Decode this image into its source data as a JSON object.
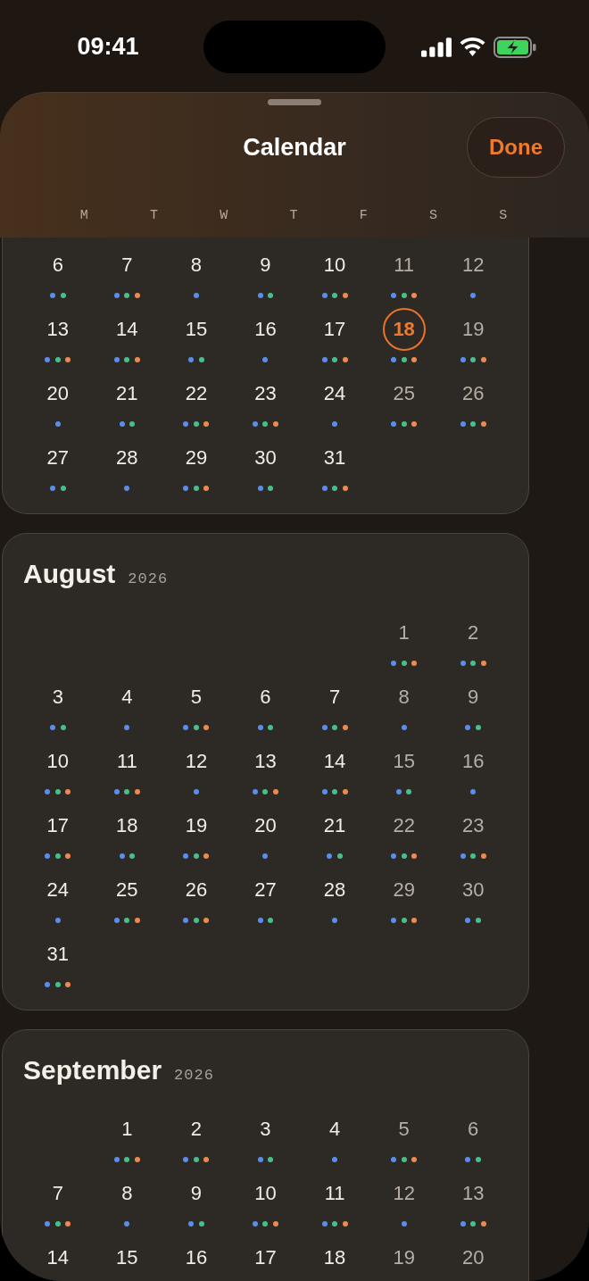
{
  "status_bar": {
    "time": "09:41"
  },
  "sheet": {
    "title": "Calendar",
    "done_button": "Done",
    "weekdays": [
      "M",
      "T",
      "W",
      "T",
      "F",
      "S",
      "S"
    ]
  },
  "months": [
    {
      "weeks": [
        [
          {
            "kind": "day",
            "label": "6",
            "weekend": false,
            "selected": false,
            "dots": [
              {
                "color": "#5b8cef"
              },
              {
                "color": "#45c08b"
              }
            ]
          },
          {
            "kind": "day",
            "label": "7",
            "weekend": false,
            "selected": false,
            "dots": [
              {
                "color": "#5b8cef"
              },
              {
                "color": "#45c08b"
              },
              {
                "color": "#ec8a50"
              }
            ]
          },
          {
            "kind": "day",
            "label": "8",
            "weekend": false,
            "selected": false,
            "dots": [
              {
                "color": "#5b8cef"
              }
            ]
          },
          {
            "kind": "day",
            "label": "9",
            "weekend": false,
            "selected": false,
            "dots": [
              {
                "color": "#5b8cef"
              },
              {
                "color": "#45c08b"
              }
            ]
          },
          {
            "kind": "day",
            "label": "10",
            "weekend": false,
            "selected": false,
            "dots": [
              {
                "color": "#5b8cef"
              },
              {
                "color": "#45c08b"
              },
              {
                "color": "#ec8a50"
              }
            ]
          },
          {
            "kind": "day",
            "label": "11",
            "weekend": true,
            "selected": false,
            "dots": [
              {
                "color": "#5b8cef"
              },
              {
                "color": "#45c08b"
              },
              {
                "color": "#ec8a50"
              }
            ]
          },
          {
            "kind": "day",
            "label": "12",
            "weekend": true,
            "selected": false,
            "dots": [
              {
                "color": "#5b8cef"
              }
            ]
          }
        ],
        [
          {
            "kind": "day",
            "label": "13",
            "weekend": false,
            "selected": false,
            "dots": [
              {
                "color": "#5b8cef"
              },
              {
                "color": "#45c08b"
              },
              {
                "color": "#ec8a50"
              }
            ]
          },
          {
            "kind": "day",
            "label": "14",
            "weekend": false,
            "selected": false,
            "dots": [
              {
                "color": "#5b8cef"
              },
              {
                "color": "#45c08b"
              },
              {
                "color": "#ec8a50"
              }
            ]
          },
          {
            "kind": "day",
            "label": "15",
            "weekend": false,
            "selected": false,
            "dots": [
              {
                "color": "#5b8cef"
              },
              {
                "color": "#45c08b"
              }
            ]
          },
          {
            "kind": "day",
            "label": "16",
            "weekend": false,
            "selected": false,
            "dots": [
              {
                "color": "#5b8cef"
              }
            ]
          },
          {
            "kind": "day",
            "label": "17",
            "weekend": false,
            "selected": false,
            "dots": [
              {
                "color": "#5b8cef"
              },
              {
                "color": "#45c08b"
              },
              {
                "color": "#ec8a50"
              }
            ]
          },
          {
            "kind": "day",
            "label": "18",
            "selected": true,
            "dots": [
              {
                "color": "#5b8cef"
              },
              {
                "color": "#45c08b"
              },
              {
                "color": "#ec8a50"
              }
            ]
          },
          {
            "kind": "day",
            "label": "19",
            "weekend": true,
            "selected": false,
            "dots": [
              {
                "color": "#5b8cef"
              },
              {
                "color": "#45c08b"
              },
              {
                "color": "#ec8a50"
              }
            ]
          }
        ],
        [
          {
            "kind": "day",
            "label": "20",
            "weekend": false,
            "selected": false,
            "dots": [
              {
                "color": "#5b8cef"
              }
            ]
          },
          {
            "kind": "day",
            "label": "21",
            "weekend": false,
            "selected": false,
            "dots": [
              {
                "color": "#5b8cef"
              },
              {
                "color": "#45c08b"
              }
            ]
          },
          {
            "kind": "day",
            "label": "22",
            "weekend": false,
            "selected": false,
            "dots": [
              {
                "color": "#5b8cef"
              },
              {
                "color": "#45c08b"
              },
              {
                "color": "#ec8a50"
              }
            ]
          },
          {
            "kind": "day",
            "label": "23",
            "weekend": false,
            "selected": false,
            "dots": [
              {
                "color": "#5b8cef"
              },
              {
                "color": "#45c08b"
              },
              {
                "color": "#ec8a50"
              }
            ]
          },
          {
            "kind": "day",
            "label": "24",
            "weekend": false,
            "selected": false,
            "dots": [
              {
                "color": "#5b8cef"
              }
            ]
          },
          {
            "kind": "day",
            "label": "25",
            "weekend": true,
            "selected": false,
            "dots": [
              {
                "color": "#5b8cef"
              },
              {
                "color": "#45c08b"
              },
              {
                "color": "#ec8a50"
              }
            ]
          },
          {
            "kind": "day",
            "label": "26",
            "weekend": true,
            "selected": false,
            "dots": [
              {
                "color": "#5b8cef"
              },
              {
                "color": "#45c08b"
              },
              {
                "color": "#ec8a50"
              }
            ]
          }
        ],
        [
          {
            "kind": "day",
            "label": "27",
            "weekend": false,
            "selected": false,
            "dots": [
              {
                "color": "#5b8cef"
              },
              {
                "color": "#45c08b"
              }
            ]
          },
          {
            "kind": "day",
            "label": "28",
            "weekend": false,
            "selected": false,
            "dots": [
              {
                "color": "#5b8cef"
              }
            ]
          },
          {
            "kind": "day",
            "label": "29",
            "weekend": false,
            "selected": false,
            "dots": [
              {
                "color": "#5b8cef"
              },
              {
                "color": "#45c08b"
              },
              {
                "color": "#ec8a50"
              }
            ]
          },
          {
            "kind": "day",
            "label": "30",
            "weekend": false,
            "selected": false,
            "dots": [
              {
                "color": "#5b8cef"
              },
              {
                "color": "#45c08b"
              }
            ]
          },
          {
            "kind": "day",
            "label": "31",
            "weekend": false,
            "selected": false,
            "dots": [
              {
                "color": "#5b8cef"
              },
              {
                "color": "#45c08b"
              },
              {
                "color": "#ec8a50"
              }
            ]
          }
        ]
      ]
    },
    {
      "name": "August",
      "year": "2026",
      "weeks": [
        [
          {
            "kind": "empty"
          },
          {
            "kind": "empty"
          },
          {
            "kind": "empty"
          },
          {
            "kind": "empty"
          },
          {
            "kind": "empty"
          },
          {
            "kind": "day",
            "label": "1",
            "weekend": true,
            "selected": false,
            "dots": [
              {
                "color": "#5b8cef"
              },
              {
                "color": "#45c08b"
              },
              {
                "color": "#ec8a50"
              }
            ]
          },
          {
            "kind": "day",
            "label": "2",
            "weekend": true,
            "selected": false,
            "dots": [
              {
                "color": "#5b8cef"
              },
              {
                "color": "#45c08b"
              },
              {
                "color": "#ec8a50"
              }
            ]
          }
        ],
        [
          {
            "kind": "day",
            "label": "3",
            "weekend": false,
            "selected": false,
            "dots": [
              {
                "color": "#5b8cef"
              },
              {
                "color": "#45c08b"
              }
            ]
          },
          {
            "kind": "day",
            "label": "4",
            "weekend": false,
            "selected": false,
            "dots": [
              {
                "color": "#5b8cef"
              }
            ]
          },
          {
            "kind": "day",
            "label": "5",
            "weekend": false,
            "selected": false,
            "dots": [
              {
                "color": "#5b8cef"
              },
              {
                "color": "#45c08b"
              },
              {
                "color": "#ec8a50"
              }
            ]
          },
          {
            "kind": "day",
            "label": "6",
            "weekend": false,
            "selected": false,
            "dots": [
              {
                "color": "#5b8cef"
              },
              {
                "color": "#45c08b"
              }
            ]
          },
          {
            "kind": "day",
            "label": "7",
            "weekend": false,
            "selected": false,
            "dots": [
              {
                "color": "#5b8cef"
              },
              {
                "color": "#45c08b"
              },
              {
                "color": "#ec8a50"
              }
            ]
          },
          {
            "kind": "day",
            "label": "8",
            "weekend": true,
            "selected": false,
            "dots": [
              {
                "color": "#5b8cef"
              }
            ]
          },
          {
            "kind": "day",
            "label": "9",
            "weekend": true,
            "selected": false,
            "dots": [
              {
                "color": "#5b8cef"
              },
              {
                "color": "#45c08b"
              }
            ]
          }
        ],
        [
          {
            "kind": "day",
            "label": "10",
            "weekend": false,
            "selected": false,
            "dots": [
              {
                "color": "#5b8cef"
              },
              {
                "color": "#45c08b"
              },
              {
                "color": "#ec8a50"
              }
            ]
          },
          {
            "kind": "day",
            "label": "11",
            "weekend": false,
            "selected": false,
            "dots": [
              {
                "color": "#5b8cef"
              },
              {
                "color": "#45c08b"
              },
              {
                "color": "#ec8a50"
              }
            ]
          },
          {
            "kind": "day",
            "label": "12",
            "weekend": false,
            "selected": false,
            "dots": [
              {
                "color": "#5b8cef"
              }
            ]
          },
          {
            "kind": "day",
            "label": "13",
            "weekend": false,
            "selected": false,
            "dots": [
              {
                "color": "#5b8cef"
              },
              {
                "color": "#45c08b"
              },
              {
                "color": "#ec8a50"
              }
            ]
          },
          {
            "kind": "day",
            "label": "14",
            "weekend": false,
            "selected": false,
            "dots": [
              {
                "color": "#5b8cef"
              },
              {
                "color": "#45c08b"
              },
              {
                "color": "#ec8a50"
              }
            ]
          },
          {
            "kind": "day",
            "label": "15",
            "weekend": true,
            "selected": false,
            "dots": [
              {
                "color": "#5b8cef"
              },
              {
                "color": "#45c08b"
              }
            ]
          },
          {
            "kind": "day",
            "label": "16",
            "weekend": true,
            "selected": false,
            "dots": [
              {
                "color": "#5b8cef"
              }
            ]
          }
        ],
        [
          {
            "kind": "day",
            "label": "17",
            "weekend": false,
            "selected": false,
            "dots": [
              {
                "color": "#5b8cef"
              },
              {
                "color": "#45c08b"
              },
              {
                "color": "#ec8a50"
              }
            ]
          },
          {
            "kind": "day",
            "label": "18",
            "weekend": false,
            "selected": false,
            "dots": [
              {
                "color": "#5b8cef"
              },
              {
                "color": "#45c08b"
              }
            ]
          },
          {
            "kind": "day",
            "label": "19",
            "weekend": false,
            "selected": false,
            "dots": [
              {
                "color": "#5b8cef"
              },
              {
                "color": "#45c08b"
              },
              {
                "color": "#ec8a50"
              }
            ]
          },
          {
            "kind": "day",
            "label": "20",
            "weekend": false,
            "selected": false,
            "dots": [
              {
                "color": "#5b8cef"
              }
            ]
          },
          {
            "kind": "day",
            "label": "21",
            "weekend": false,
            "selected": false,
            "dots": [
              {
                "color": "#5b8cef"
              },
              {
                "color": "#45c08b"
              }
            ]
          },
          {
            "kind": "day",
            "label": "22",
            "weekend": true,
            "selected": false,
            "dots": [
              {
                "color": "#5b8cef"
              },
              {
                "color": "#45c08b"
              },
              {
                "color": "#ec8a50"
              }
            ]
          },
          {
            "kind": "day",
            "label": "23",
            "weekend": true,
            "selected": false,
            "dots": [
              {
                "color": "#5b8cef"
              },
              {
                "color": "#45c08b"
              },
              {
                "color": "#ec8a50"
              }
            ]
          }
        ],
        [
          {
            "kind": "day",
            "label": "24",
            "weekend": false,
            "selected": false,
            "dots": [
              {
                "color": "#5b8cef"
              }
            ]
          },
          {
            "kind": "day",
            "label": "25",
            "weekend": false,
            "selected": false,
            "dots": [
              {
                "color": "#5b8cef"
              },
              {
                "color": "#45c08b"
              },
              {
                "color": "#ec8a50"
              }
            ]
          },
          {
            "kind": "day",
            "label": "26",
            "weekend": false,
            "selected": false,
            "dots": [
              {
                "color": "#5b8cef"
              },
              {
                "color": "#45c08b"
              },
              {
                "color": "#ec8a50"
              }
            ]
          },
          {
            "kind": "day",
            "label": "27",
            "weekend": false,
            "selected": false,
            "dots": [
              {
                "color": "#5b8cef"
              },
              {
                "color": "#45c08b"
              }
            ]
          },
          {
            "kind": "day",
            "label": "28",
            "weekend": false,
            "selected": false,
            "dots": [
              {
                "color": "#5b8cef"
              }
            ]
          },
          {
            "kind": "day",
            "label": "29",
            "weekend": true,
            "selected": false,
            "dots": [
              {
                "color": "#5b8cef"
              },
              {
                "color": "#45c08b"
              },
              {
                "color": "#ec8a50"
              }
            ]
          },
          {
            "kind": "day",
            "label": "30",
            "weekend": true,
            "selected": false,
            "dots": [
              {
                "color": "#5b8cef"
              },
              {
                "color": "#45c08b"
              }
            ]
          }
        ],
        [
          {
            "kind": "day",
            "label": "31",
            "weekend": false,
            "selected": false,
            "dots": [
              {
                "color": "#5b8cef"
              },
              {
                "color": "#45c08b"
              },
              {
                "color": "#ec8a50"
              }
            ]
          }
        ]
      ]
    },
    {
      "name": "September",
      "year": "2026",
      "weeks": [
        [
          {
            "kind": "empty"
          },
          {
            "kind": "day",
            "label": "1",
            "weekend": false,
            "selected": false,
            "dots": [
              {
                "color": "#5b8cef"
              },
              {
                "color": "#45c08b"
              },
              {
                "color": "#ec8a50"
              }
            ]
          },
          {
            "kind": "day",
            "label": "2",
            "weekend": false,
            "selected": false,
            "dots": [
              {
                "color": "#5b8cef"
              },
              {
                "color": "#45c08b"
              },
              {
                "color": "#ec8a50"
              }
            ]
          },
          {
            "kind": "day",
            "label": "3",
            "weekend": false,
            "selected": false,
            "dots": [
              {
                "color": "#5b8cef"
              },
              {
                "color": "#45c08b"
              }
            ]
          },
          {
            "kind": "day",
            "label": "4",
            "weekend": false,
            "selected": false,
            "dots": [
              {
                "color": "#5b8cef"
              }
            ]
          },
          {
            "kind": "day",
            "label": "5",
            "weekend": true,
            "selected": false,
            "dots": [
              {
                "color": "#5b8cef"
              },
              {
                "color": "#45c08b"
              },
              {
                "color": "#ec8a50"
              }
            ]
          },
          {
            "kind": "day",
            "label": "6",
            "weekend": true,
            "selected": false,
            "dots": [
              {
                "color": "#5b8cef"
              },
              {
                "color": "#45c08b"
              }
            ]
          }
        ],
        [
          {
            "kind": "day",
            "label": "7",
            "weekend": false,
            "selected": false,
            "dots": [
              {
                "color": "#5b8cef"
              },
              {
                "color": "#45c08b"
              },
              {
                "color": "#ec8a50"
              }
            ]
          },
          {
            "kind": "day",
            "label": "8",
            "weekend": false,
            "selected": false,
            "dots": [
              {
                "color": "#5b8cef"
              }
            ]
          },
          {
            "kind": "day",
            "label": "9",
            "weekend": false,
            "selected": false,
            "dots": [
              {
                "color": "#5b8cef"
              },
              {
                "color": "#45c08b"
              }
            ]
          },
          {
            "kind": "day",
            "label": "10",
            "weekend": false,
            "selected": false,
            "dots": [
              {
                "color": "#5b8cef"
              },
              {
                "color": "#45c08b"
              },
              {
                "color": "#ec8a50"
              }
            ]
          },
          {
            "kind": "day",
            "label": "11",
            "weekend": false,
            "selected": false,
            "dots": [
              {
                "color": "#5b8cef"
              },
              {
                "color": "#45c08b"
              },
              {
                "color": "#ec8a50"
              }
            ]
          },
          {
            "kind": "day",
            "label": "12",
            "weekend": true,
            "selected": false,
            "dots": [
              {
                "color": "#5b8cef"
              }
            ]
          },
          {
            "kind": "day",
            "label": "13",
            "weekend": true,
            "selected": false,
            "dots": [
              {
                "color": "#5b8cef"
              },
              {
                "color": "#45c08b"
              },
              {
                "color": "#ec8a50"
              }
            ]
          }
        ],
        [
          {
            "kind": "day",
            "label": "14",
            "weekend": false,
            "selected": false
          },
          {
            "kind": "day",
            "label": "15",
            "weekend": false,
            "selected": false
          },
          {
            "kind": "day",
            "label": "16",
            "weekend": false,
            "selected": false
          },
          {
            "kind": "day",
            "label": "17",
            "weekend": false,
            "selected": false
          },
          {
            "kind": "day",
            "label": "18",
            "weekend": false,
            "selected": false
          },
          {
            "kind": "day",
            "label": "19",
            "weekend": true,
            "selected": false
          },
          {
            "kind": "day",
            "label": "20",
            "weekend": true,
            "selected": false
          }
        ]
      ]
    }
  ]
}
